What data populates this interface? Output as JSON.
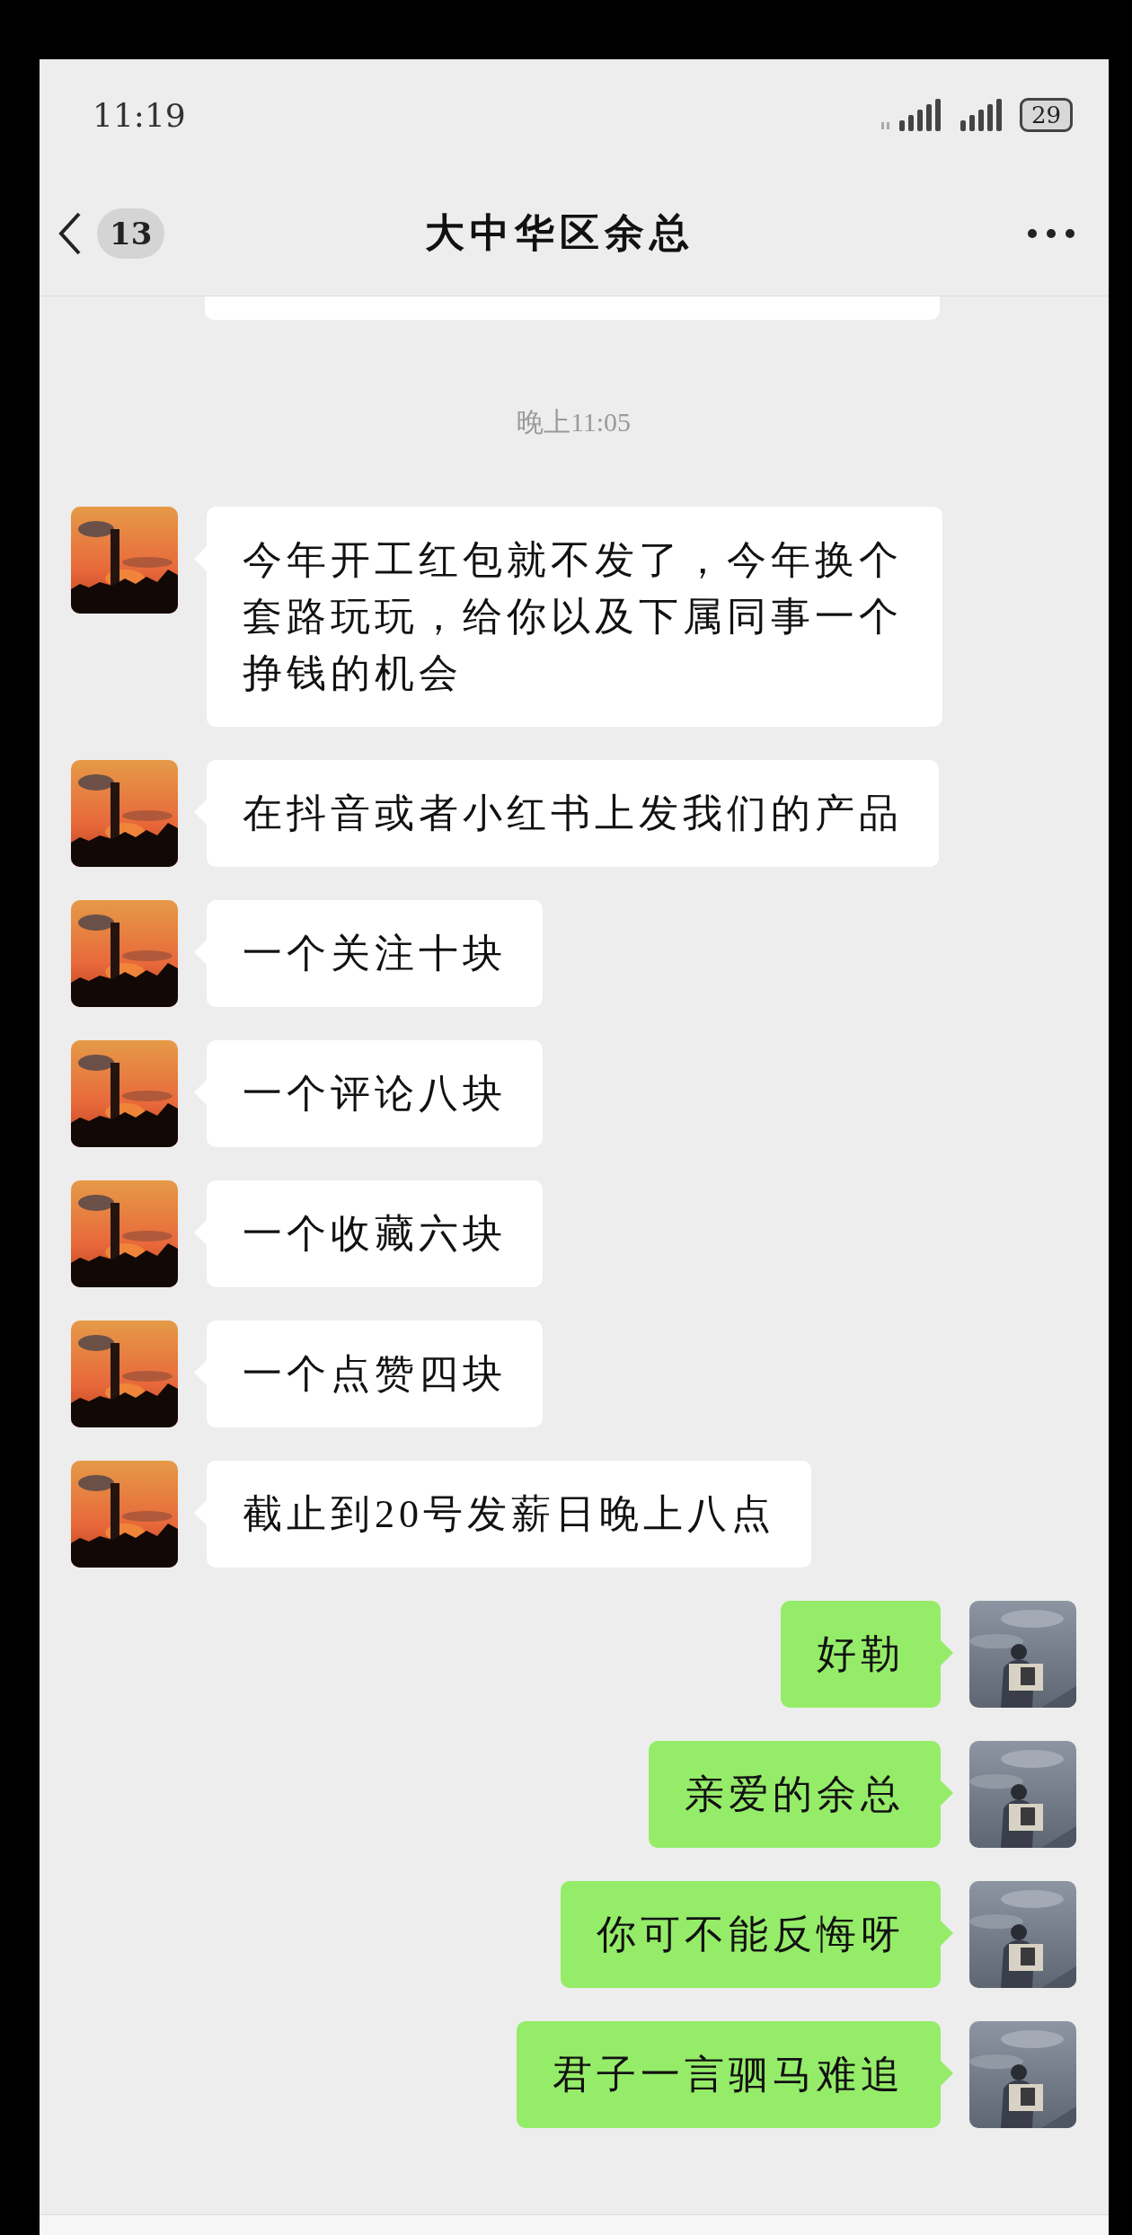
{
  "status_bar": {
    "time": "11:19",
    "battery": "29"
  },
  "header": {
    "unread_count": "13",
    "title": "大中华区余总"
  },
  "timestamp": "晚上11:05",
  "messages": [
    {
      "kind": "received",
      "text": "今年开工红包就不发了，今年换个套路玩玩，给你以及下属同事一个挣钱的机会"
    },
    {
      "kind": "received",
      "text": "在抖音或者小红书上发我们的产品"
    },
    {
      "kind": "received",
      "text": "一个关注十块"
    },
    {
      "kind": "received",
      "text": "一个评论八块"
    },
    {
      "kind": "received",
      "text": "一个收藏六块"
    },
    {
      "kind": "received",
      "text": "一个点赞四块"
    },
    {
      "kind": "received",
      "text": "截止到20号发薪日晚上八点"
    },
    {
      "kind": "sent",
      "text": "好勒"
    },
    {
      "kind": "sent",
      "text": "亲爱的余总"
    },
    {
      "kind": "sent",
      "text": "你可不能反悔呀"
    },
    {
      "kind": "sent",
      "text": "君子一言驷马难追"
    }
  ]
}
